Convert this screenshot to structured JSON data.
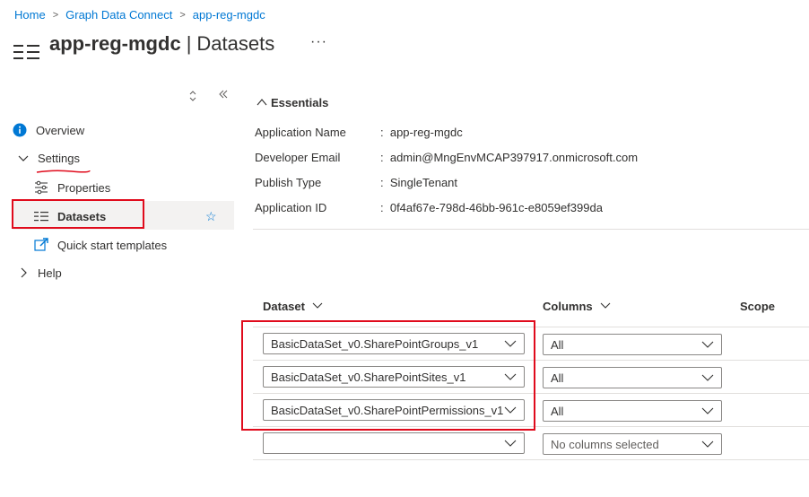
{
  "breadcrumb": [
    "Home",
    "Graph Data Connect",
    "app-reg-mgdc"
  ],
  "header": {
    "title_name": "app-reg-mgdc",
    "title_separator": "|",
    "title_section": "Datasets",
    "more": "···"
  },
  "nav": {
    "items": [
      {
        "label": "Overview",
        "icon": "info-icon"
      },
      {
        "label": "Settings",
        "icon": "chevron-down-icon"
      },
      {
        "label": "Properties",
        "icon": "sliders-icon"
      },
      {
        "label": "Datasets",
        "icon": "list-icon",
        "selected": true
      },
      {
        "label": "Quick start templates",
        "icon": "external-link-icon"
      },
      {
        "label": "Help",
        "icon": "chevron-right-icon"
      }
    ]
  },
  "essentials": {
    "heading": "Essentials",
    "rows": [
      {
        "label": "Application Name",
        "value": "app-reg-mgdc"
      },
      {
        "label": "Developer Email",
        "value": "admin@MngEnvMCAP397917.onmicrosoft.com"
      },
      {
        "label": "Publish Type",
        "value": "SingleTenant"
      },
      {
        "label": "Application ID",
        "value": "0f4af67e-798d-46bb-961c-e8059ef399da"
      }
    ]
  },
  "table": {
    "headers": {
      "dataset": "Dataset",
      "columns": "Columns",
      "scope": "Scope"
    },
    "rows": [
      {
        "dataset": "BasicDataSet_v0.SharePointGroups_v1",
        "columns": "All"
      },
      {
        "dataset": "BasicDataSet_v0.SharePointSites_v1",
        "columns": "All"
      },
      {
        "dataset": "BasicDataSet_v0.SharePointPermissions_v1",
        "columns": "All"
      },
      {
        "dataset": "",
        "columns": "No columns selected"
      }
    ]
  },
  "colors": {
    "accent": "#0078d4",
    "highlight": "#e00b1c",
    "selected_bg": "#f3f2f1"
  }
}
